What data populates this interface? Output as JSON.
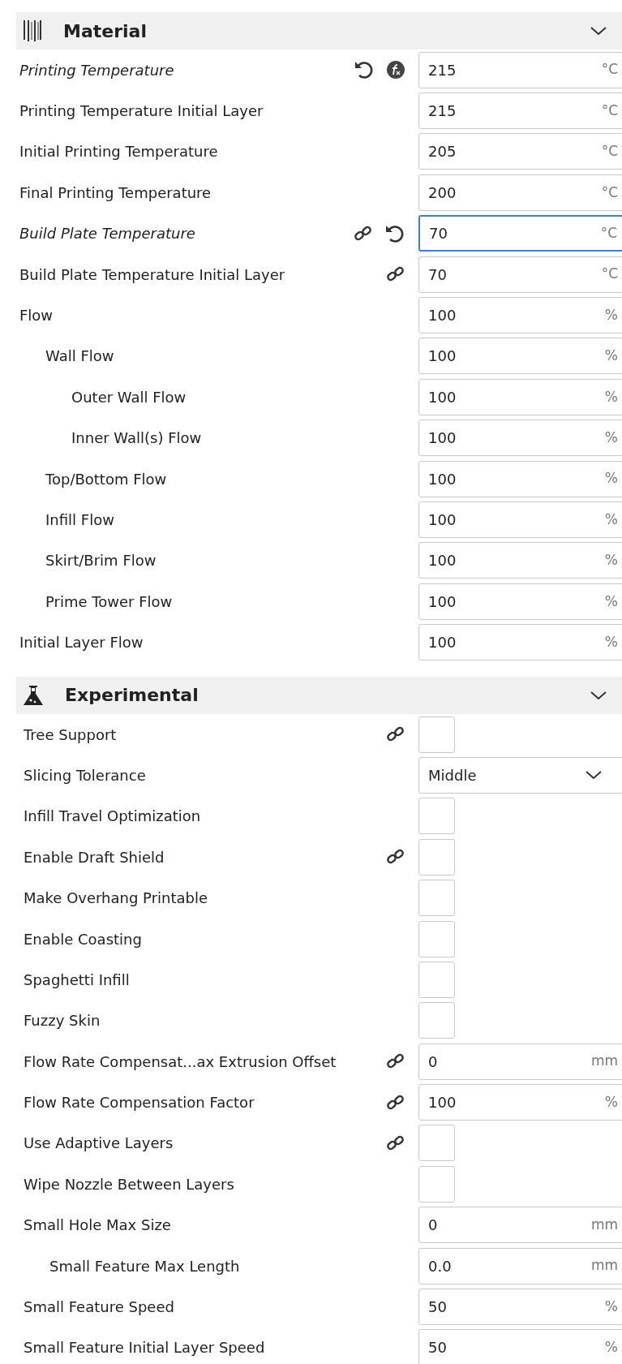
{
  "sections": [
    {
      "title": "Material",
      "rows": [
        {
          "label": "Printing Temperature",
          "modified": true,
          "resettable": true,
          "formula": true,
          "control": {
            "kind": "number",
            "value": "215",
            "unit": "°C",
            "focused": false
          }
        },
        {
          "label": "Printing Temperature Initial Layer",
          "modified": false,
          "control": {
            "kind": "number",
            "value": "215",
            "unit": "°C",
            "focused": false
          }
        },
        {
          "label": "Initial Printing Temperature",
          "modified": false,
          "control": {
            "kind": "number",
            "value": "205",
            "unit": "°C",
            "focused": false
          }
        },
        {
          "label": "Final Printing Temperature",
          "modified": false,
          "control": {
            "kind": "number",
            "value": "200",
            "unit": "°C",
            "focused": false
          }
        },
        {
          "label": "Build Plate Temperature",
          "modified": true,
          "linked": true,
          "resettable": true,
          "control": {
            "kind": "number",
            "value": "70",
            "unit": "°C",
            "focused": true
          }
        },
        {
          "label": "Build Plate Temperature Initial Layer",
          "modified": false,
          "linked": true,
          "control": {
            "kind": "number",
            "value": "70",
            "unit": "°C",
            "focused": false
          }
        },
        {
          "label": "Flow",
          "modified": false,
          "control": {
            "kind": "number",
            "value": "100",
            "unit": "%",
            "focused": false
          },
          "children": [
            {
              "label": "Wall Flow",
              "modified": false,
              "control": {
                "kind": "number",
                "value": "100",
                "unit": "%",
                "focused": false
              },
              "children": [
                {
                  "label": "Outer Wall Flow",
                  "modified": false,
                  "control": {
                    "kind": "number",
                    "value": "100",
                    "unit": "%",
                    "focused": false
                  }
                },
                {
                  "label": "Inner Wall(s) Flow",
                  "modified": false,
                  "control": {
                    "kind": "number",
                    "value": "100",
                    "unit": "%",
                    "focused": false
                  }
                }
              ]
            },
            {
              "label": "Top/Bottom Flow",
              "modified": false,
              "control": {
                "kind": "number",
                "value": "100",
                "unit": "%",
                "focused": false
              }
            },
            {
              "label": "Infill Flow",
              "modified": false,
              "control": {
                "kind": "number",
                "value": "100",
                "unit": "%",
                "focused": false
              }
            },
            {
              "label": "Skirt/Brim Flow",
              "modified": false,
              "control": {
                "kind": "number",
                "value": "100",
                "unit": "%",
                "focused": false
              }
            },
            {
              "label": "Prime Tower Flow",
              "modified": false,
              "control": {
                "kind": "number",
                "value": "100",
                "unit": "%",
                "focused": false
              }
            }
          ]
        },
        {
          "label": "Initial Layer Flow",
          "modified": false,
          "control": {
            "kind": "number",
            "value": "100",
            "unit": "%",
            "focused": false
          }
        }
      ]
    },
    {
      "title": "Experimental",
      "rows": [
        {
          "label": "Tree Support",
          "modified": false,
          "linked": true,
          "control": {
            "kind": "checkbox",
            "checked": false
          }
        },
        {
          "label": "Slicing Tolerance",
          "modified": false,
          "control": {
            "kind": "select",
            "value": "Middle"
          }
        },
        {
          "label": "Infill Travel Optimization",
          "modified": false,
          "control": {
            "kind": "checkbox",
            "checked": false
          }
        },
        {
          "label": "Enable Draft Shield",
          "modified": false,
          "linked": true,
          "control": {
            "kind": "checkbox",
            "checked": false
          }
        },
        {
          "label": "Make Overhang Printable",
          "modified": false,
          "control": {
            "kind": "checkbox",
            "checked": false
          }
        },
        {
          "label": "Enable Coasting",
          "modified": false,
          "control": {
            "kind": "checkbox",
            "checked": false
          }
        },
        {
          "label": "Spaghetti Infill",
          "modified": false,
          "control": {
            "kind": "checkbox",
            "checked": false
          }
        },
        {
          "label": "Fuzzy Skin",
          "modified": false,
          "control": {
            "kind": "checkbox",
            "checked": false
          }
        },
        {
          "label": "Flow Rate Compensat...ax Extrusion Offset",
          "modified": false,
          "linked": true,
          "control": {
            "kind": "number",
            "value": "0",
            "unit": "mm",
            "focused": false
          }
        },
        {
          "label": "Flow Rate Compensation Factor",
          "modified": false,
          "linked": true,
          "control": {
            "kind": "number",
            "value": "100",
            "unit": "%",
            "focused": false
          }
        },
        {
          "label": "Use Adaptive Layers",
          "modified": false,
          "linked": true,
          "control": {
            "kind": "checkbox",
            "checked": false
          }
        },
        {
          "label": "Wipe Nozzle Between Layers",
          "modified": false,
          "control": {
            "kind": "checkbox",
            "checked": false
          }
        },
        {
          "label": "Small Hole Max Size",
          "modified": false,
          "control": {
            "kind": "number",
            "value": "0",
            "unit": "mm",
            "focused": false
          },
          "children": [
            {
              "label": "Small Feature Max Length",
              "modified": false,
              "control": {
                "kind": "number",
                "value": "0.0",
                "unit": "mm",
                "focused": false
              }
            }
          ]
        },
        {
          "label": "Small Feature Speed",
          "modified": false,
          "control": {
            "kind": "number",
            "value": "50",
            "unit": "%",
            "focused": false
          }
        },
        {
          "label": "Small Feature Initial Layer Speed",
          "modified": false,
          "control": {
            "kind": "number",
            "value": "50",
            "unit": "%",
            "focused": false
          }
        }
      ]
    }
  ]
}
